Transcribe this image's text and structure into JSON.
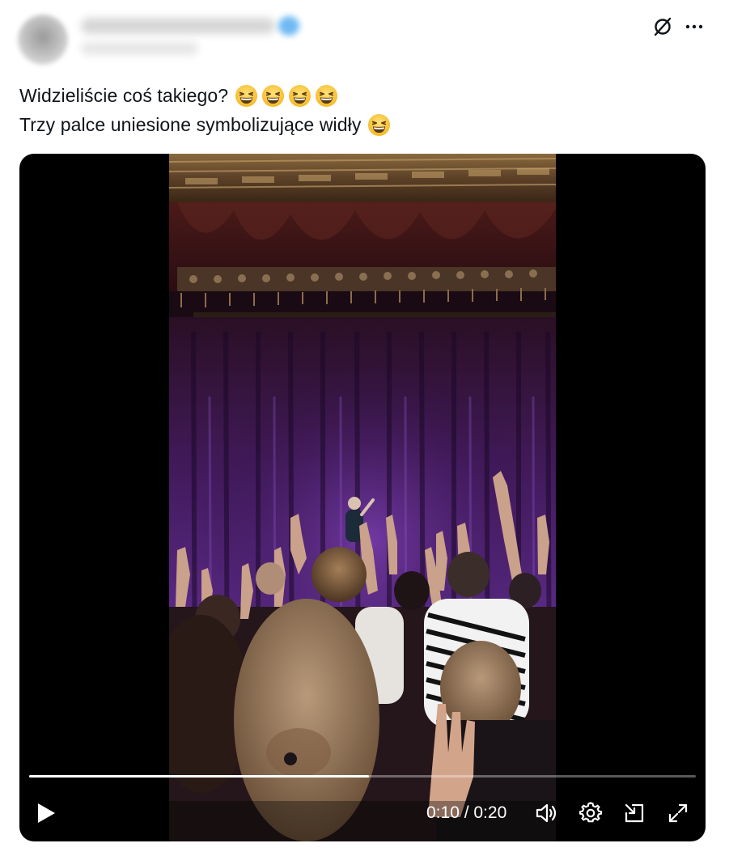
{
  "post": {
    "text_line1": "Widzieliście coś takiego?",
    "line1_emojis": [
      "grinning-squinting-face",
      "grinning-squinting-face",
      "grinning-squinting-face",
      "grinning-squinting-face"
    ],
    "text_line2": "Trzy palce uniesione symbolizujące widły",
    "line2_emojis": [
      "grinning-squinting-face"
    ]
  },
  "header": {
    "author_name_blurred": true,
    "author_handle_blurred": true,
    "verified_badge_color": "#1d9bf0",
    "icons": [
      "grok-icon",
      "more-icon"
    ]
  },
  "video": {
    "time": "0:10 / 0:20",
    "progress": 0.51,
    "controls": [
      "play-icon",
      "volume-icon",
      "settings-icon",
      "pip-icon",
      "fullscreen-icon"
    ]
  },
  "colors": {
    "text": "#0f1419",
    "video_bg": "#000000",
    "curtain": "#4a1a6b"
  }
}
